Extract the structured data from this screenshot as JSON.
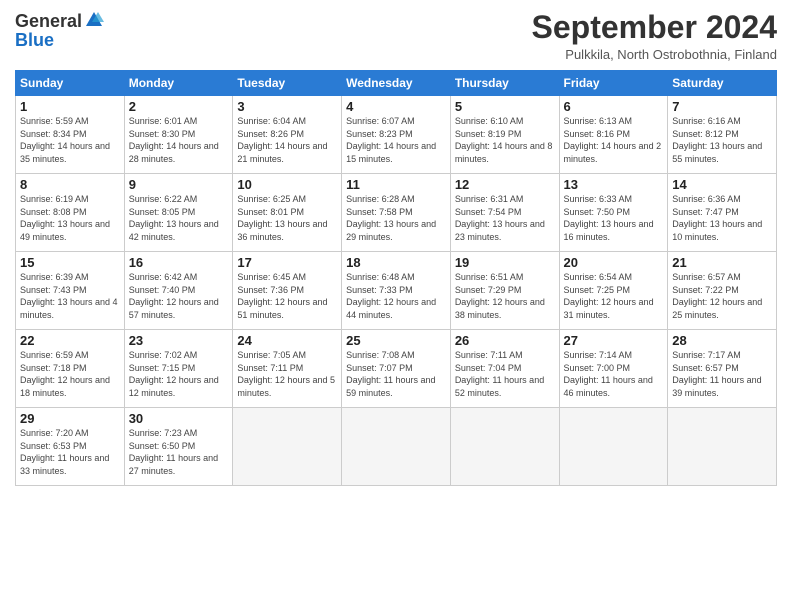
{
  "header": {
    "logo_general": "General",
    "logo_blue": "Blue",
    "month_title": "September 2024",
    "location": "Pulkkila, North Ostrobothnia, Finland"
  },
  "days_of_week": [
    "Sunday",
    "Monday",
    "Tuesday",
    "Wednesday",
    "Thursday",
    "Friday",
    "Saturday"
  ],
  "weeks": [
    [
      {
        "day": "1",
        "sunrise": "5:59 AM",
        "sunset": "8:34 PM",
        "daylight": "14 hours and 35 minutes."
      },
      {
        "day": "2",
        "sunrise": "6:01 AM",
        "sunset": "8:30 PM",
        "daylight": "14 hours and 28 minutes."
      },
      {
        "day": "3",
        "sunrise": "6:04 AM",
        "sunset": "8:26 PM",
        "daylight": "14 hours and 21 minutes."
      },
      {
        "day": "4",
        "sunrise": "6:07 AM",
        "sunset": "8:23 PM",
        "daylight": "14 hours and 15 minutes."
      },
      {
        "day": "5",
        "sunrise": "6:10 AM",
        "sunset": "8:19 PM",
        "daylight": "14 hours and 8 minutes."
      },
      {
        "day": "6",
        "sunrise": "6:13 AM",
        "sunset": "8:16 PM",
        "daylight": "14 hours and 2 minutes."
      },
      {
        "day": "7",
        "sunrise": "6:16 AM",
        "sunset": "8:12 PM",
        "daylight": "13 hours and 55 minutes."
      }
    ],
    [
      {
        "day": "8",
        "sunrise": "6:19 AM",
        "sunset": "8:08 PM",
        "daylight": "13 hours and 49 minutes."
      },
      {
        "day": "9",
        "sunrise": "6:22 AM",
        "sunset": "8:05 PM",
        "daylight": "13 hours and 42 minutes."
      },
      {
        "day": "10",
        "sunrise": "6:25 AM",
        "sunset": "8:01 PM",
        "daylight": "13 hours and 36 minutes."
      },
      {
        "day": "11",
        "sunrise": "6:28 AM",
        "sunset": "7:58 PM",
        "daylight": "13 hours and 29 minutes."
      },
      {
        "day": "12",
        "sunrise": "6:31 AM",
        "sunset": "7:54 PM",
        "daylight": "13 hours and 23 minutes."
      },
      {
        "day": "13",
        "sunrise": "6:33 AM",
        "sunset": "7:50 PM",
        "daylight": "13 hours and 16 minutes."
      },
      {
        "day": "14",
        "sunrise": "6:36 AM",
        "sunset": "7:47 PM",
        "daylight": "13 hours and 10 minutes."
      }
    ],
    [
      {
        "day": "15",
        "sunrise": "6:39 AM",
        "sunset": "7:43 PM",
        "daylight": "13 hours and 4 minutes."
      },
      {
        "day": "16",
        "sunrise": "6:42 AM",
        "sunset": "7:40 PM",
        "daylight": "12 hours and 57 minutes."
      },
      {
        "day": "17",
        "sunrise": "6:45 AM",
        "sunset": "7:36 PM",
        "daylight": "12 hours and 51 minutes."
      },
      {
        "day": "18",
        "sunrise": "6:48 AM",
        "sunset": "7:33 PM",
        "daylight": "12 hours and 44 minutes."
      },
      {
        "day": "19",
        "sunrise": "6:51 AM",
        "sunset": "7:29 PM",
        "daylight": "12 hours and 38 minutes."
      },
      {
        "day": "20",
        "sunrise": "6:54 AM",
        "sunset": "7:25 PM",
        "daylight": "12 hours and 31 minutes."
      },
      {
        "day": "21",
        "sunrise": "6:57 AM",
        "sunset": "7:22 PM",
        "daylight": "12 hours and 25 minutes."
      }
    ],
    [
      {
        "day": "22",
        "sunrise": "6:59 AM",
        "sunset": "7:18 PM",
        "daylight": "12 hours and 18 minutes."
      },
      {
        "day": "23",
        "sunrise": "7:02 AM",
        "sunset": "7:15 PM",
        "daylight": "12 hours and 12 minutes."
      },
      {
        "day": "24",
        "sunrise": "7:05 AM",
        "sunset": "7:11 PM",
        "daylight": "12 hours and 5 minutes."
      },
      {
        "day": "25",
        "sunrise": "7:08 AM",
        "sunset": "7:07 PM",
        "daylight": "11 hours and 59 minutes."
      },
      {
        "day": "26",
        "sunrise": "7:11 AM",
        "sunset": "7:04 PM",
        "daylight": "11 hours and 52 minutes."
      },
      {
        "day": "27",
        "sunrise": "7:14 AM",
        "sunset": "7:00 PM",
        "daylight": "11 hours and 46 minutes."
      },
      {
        "day": "28",
        "sunrise": "7:17 AM",
        "sunset": "6:57 PM",
        "daylight": "11 hours and 39 minutes."
      }
    ],
    [
      {
        "day": "29",
        "sunrise": "7:20 AM",
        "sunset": "6:53 PM",
        "daylight": "11 hours and 33 minutes."
      },
      {
        "day": "30",
        "sunrise": "7:23 AM",
        "sunset": "6:50 PM",
        "daylight": "11 hours and 27 minutes."
      },
      null,
      null,
      null,
      null,
      null
    ]
  ]
}
